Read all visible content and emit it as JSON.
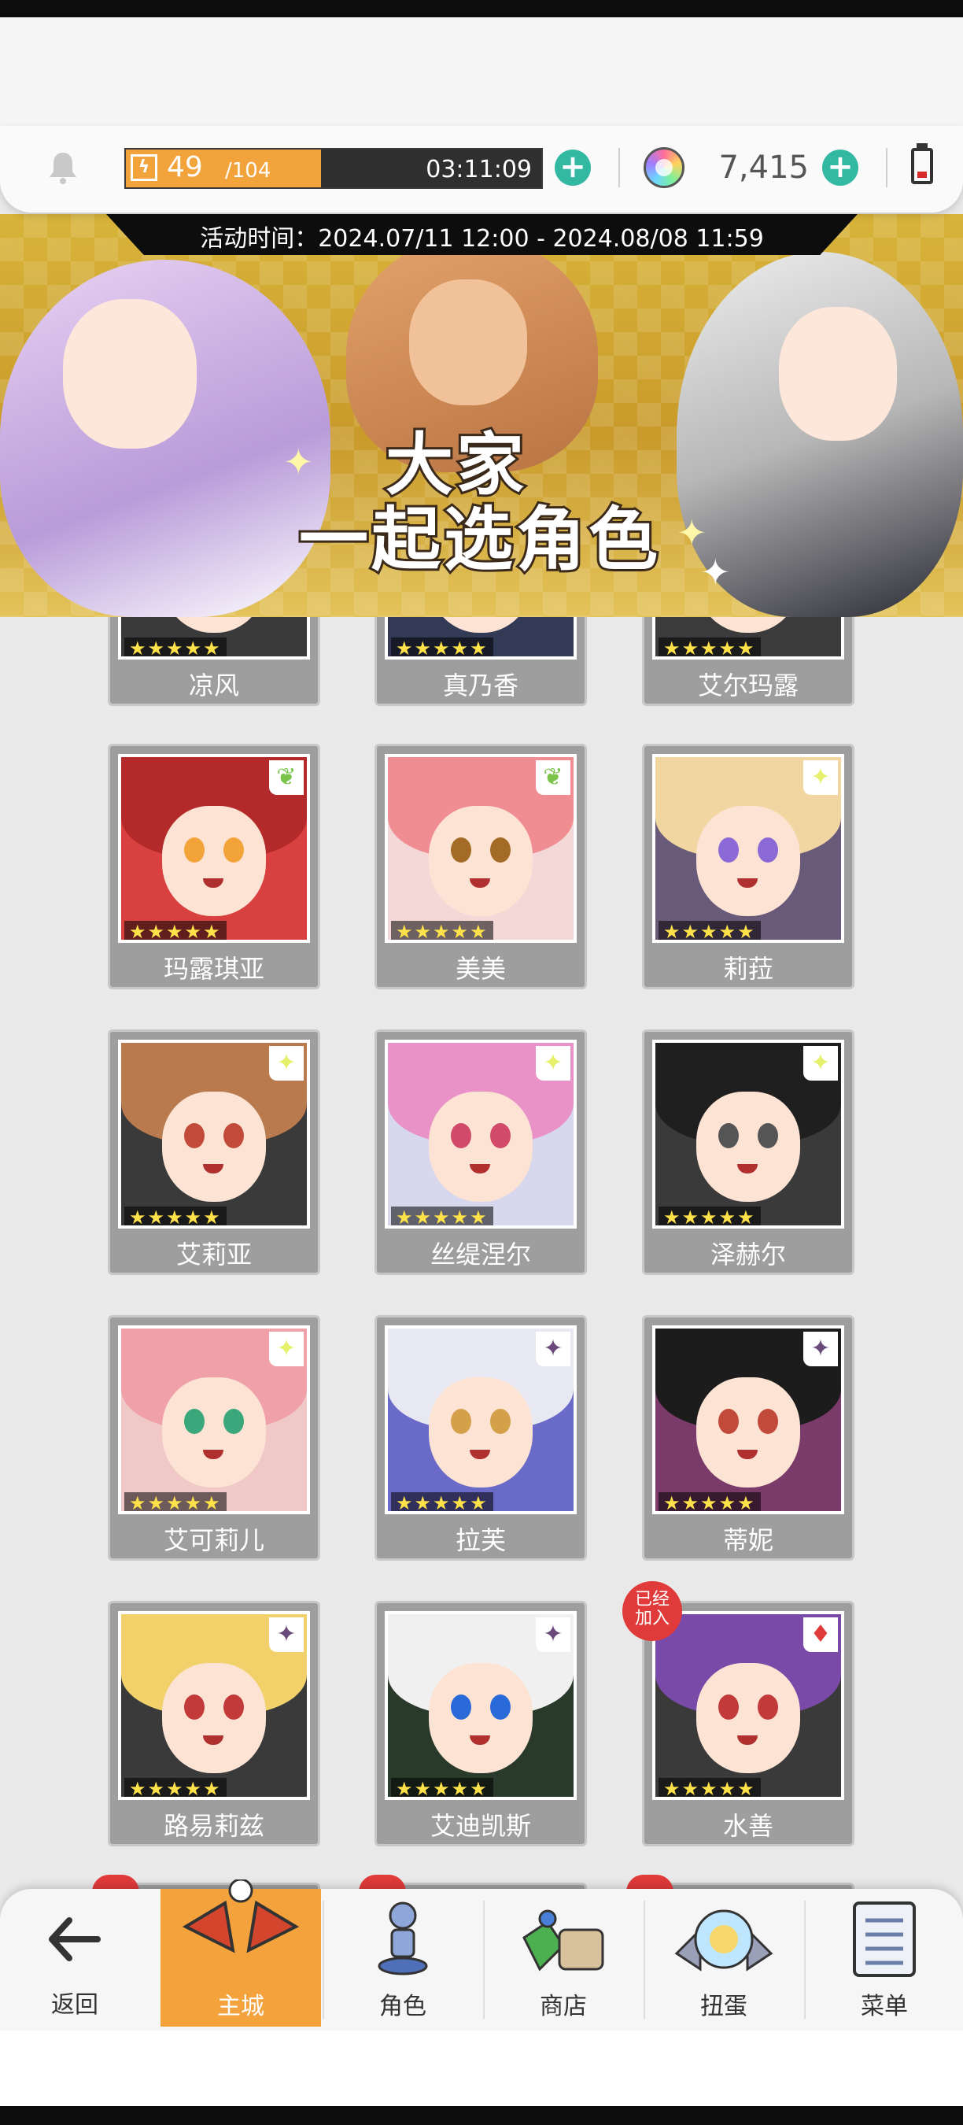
{
  "status": {
    "stamina_current": "49",
    "stamina_max": "/104",
    "stamina_fraction": 0.47,
    "stamina_timer": "03:11:09",
    "gem_count": "7,415",
    "icons": [
      "bell-icon",
      "bolt-icon",
      "plus-icon",
      "gem-icon",
      "battery-icon"
    ]
  },
  "banner": {
    "event_time": "活动时间：2024.07/11 12:00 - 2024.08/08 11:59",
    "title_line1": "大家",
    "title_line2": "一起选角色"
  },
  "characters": [
    {
      "name": "凉风",
      "stars": "★★★★★"
    },
    {
      "name": "真乃香",
      "stars": "★★★★★"
    },
    {
      "name": "艾尔玛露",
      "stars": "★★★★★"
    },
    {
      "name": "玛露琪亚",
      "stars": "★★★★★"
    },
    {
      "name": "美美",
      "stars": "★★★★★"
    },
    {
      "name": "莉菈",
      "stars": "★★★★★"
    },
    {
      "name": "艾莉亚",
      "stars": "★★★★★"
    },
    {
      "name": "丝缇涅尔",
      "stars": "★★★★★"
    },
    {
      "name": "泽赫尔",
      "stars": "★★★★★"
    },
    {
      "name": "艾可莉儿",
      "stars": "★★★★★"
    },
    {
      "name": "拉芙",
      "stars": "★★★★★"
    },
    {
      "name": "蒂妮",
      "stars": "★★★★★"
    },
    {
      "name": "路易莉兹",
      "stars": "★★★★★"
    },
    {
      "name": "艾迪凯斯",
      "stars": "★★★★★"
    },
    {
      "name": "水善",
      "stars": "★★★★★",
      "badge": "已经\n加入"
    }
  ],
  "nav": {
    "back": "返回",
    "home": "主城",
    "characters": "角色",
    "shop": "商店",
    "gacha": "扭蛋",
    "menu": "菜单"
  },
  "colors": {
    "accent_orange": "#f3a23c",
    "plus_teal": "#33b8a2",
    "badge_red": "#e03a3a",
    "star_yellow": "#ffe14a"
  }
}
